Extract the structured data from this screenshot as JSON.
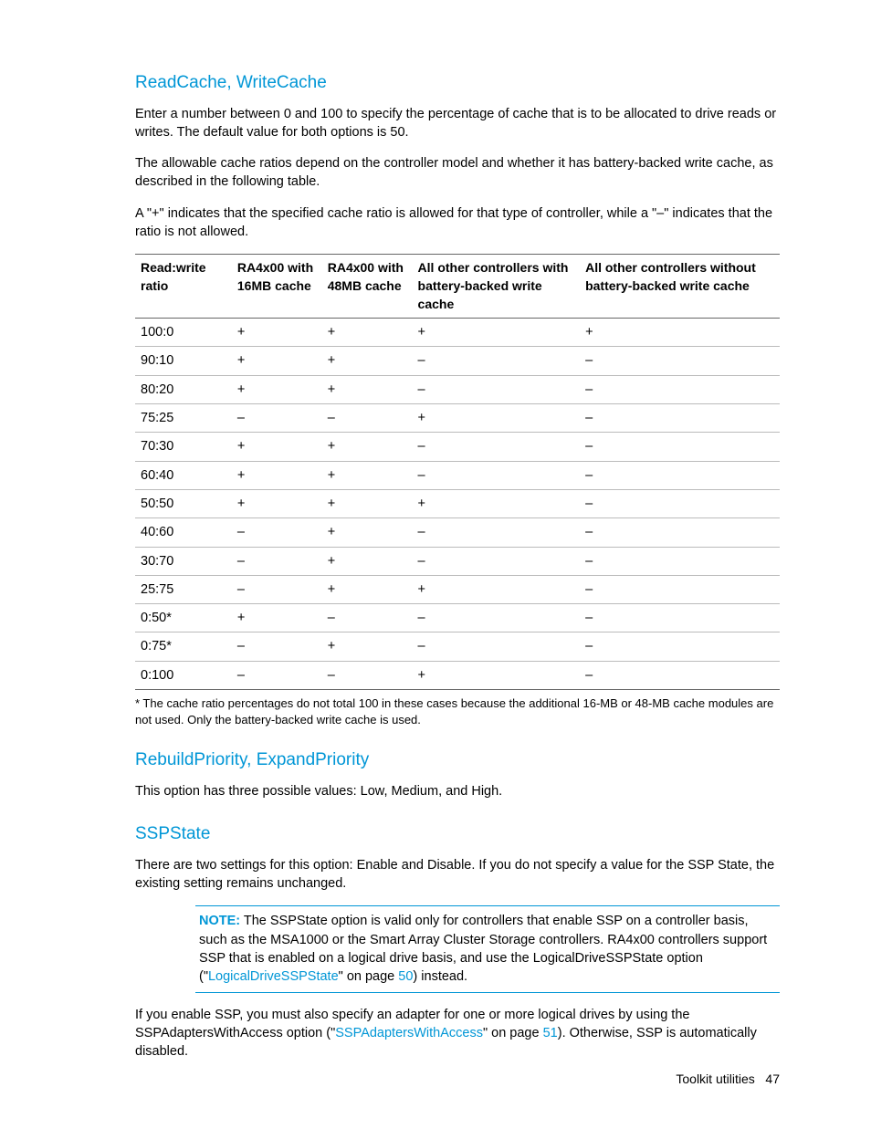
{
  "sections": {
    "readcache": {
      "heading": "ReadCache, WriteCache",
      "para1": "Enter a number between 0 and 100 to specify the percentage of cache that is to be allocated to drive reads or writes. The default value for both options is 50.",
      "para2": "The allowable cache ratios depend on the controller model and whether it has battery-backed write cache, as described in the following table.",
      "para3": "A \"+\" indicates that the specified cache ratio is allowed for that type of controller, while a \"–\" indicates that the ratio is not allowed."
    },
    "table": {
      "headers": [
        "Read:write ratio",
        "RA4x00 with 16MB cache",
        "RA4x00 with 48MB cache",
        "All other controllers with battery-backed write cache",
        "All other controllers without battery-backed write cache"
      ],
      "rows": [
        [
          "100:0",
          "+",
          "+",
          "+",
          "+"
        ],
        [
          "90:10",
          "+",
          "+",
          "–",
          "–"
        ],
        [
          "80:20",
          "+",
          "+",
          "–",
          "–"
        ],
        [
          "75:25",
          "–",
          "–",
          "+",
          "–"
        ],
        [
          "70:30",
          "+",
          "+",
          "–",
          "–"
        ],
        [
          "60:40",
          "+",
          "+",
          "–",
          "–"
        ],
        [
          "50:50",
          "+",
          "+",
          "+",
          "–"
        ],
        [
          "40:60",
          "–",
          "+",
          "–",
          "–"
        ],
        [
          "30:70",
          "–",
          "+",
          "–",
          "–"
        ],
        [
          "25:75",
          "–",
          "+",
          "+",
          "–"
        ],
        [
          "0:50*",
          "+",
          "–",
          "–",
          "–"
        ],
        [
          "0:75*",
          "–",
          "+",
          "–",
          "–"
        ],
        [
          "0:100",
          "–",
          "–",
          "+",
          "–"
        ]
      ],
      "footnote": "* The cache ratio percentages do not total 100 in these cases because the additional 16-MB or 48-MB cache modules are not used. Only the battery-backed write cache is used."
    },
    "rebuild": {
      "heading": "RebuildPriority, ExpandPriority",
      "para": "This option has three possible values: Low, Medium, and High."
    },
    "ssp": {
      "heading": "SSPState",
      "para1": "There are two settings for this option: Enable and Disable. If you do not specify a value for the SSP State, the existing setting remains unchanged.",
      "note_label": "NOTE:",
      "note_pre": "  The SSPState option is valid only for controllers that enable SSP on a controller basis, such as the MSA1000 or the Smart Array Cluster Storage controllers. RA4x00 controllers support SSP that is enabled on a logical drive basis, and use the LogicalDriveSSPState option (\"",
      "note_link": "LogicalDriveSSPState",
      "note_mid": "\" on page ",
      "note_page": "50",
      "note_post": ") instead.",
      "para2_pre": "If you enable SSP, you must also specify an adapter for one or more logical drives by using the SSPAdaptersWithAccess option (\"",
      "para2_link": "SSPAdaptersWithAccess",
      "para2_mid": "\" on page ",
      "para2_page": "51",
      "para2_post": "). Otherwise, SSP is automatically disabled."
    }
  },
  "footer": {
    "label": "Toolkit utilities",
    "page": "47"
  }
}
